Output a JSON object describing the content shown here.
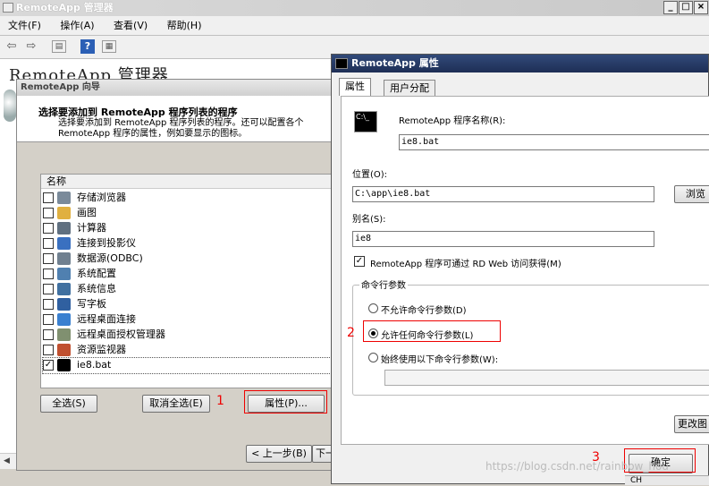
{
  "main_window": {
    "title": "RemoteApp 管理器",
    "menu": [
      "文件(F)",
      "操作(A)",
      "查看(V)",
      "帮助(H)"
    ],
    "heading": "RemoteApp 管理器"
  },
  "wizard": {
    "title": "RemoteApp 向导",
    "header_title": "选择要添加到 RemoteApp 程序列表的程序",
    "header_desc": "选择要添加到 RemoteApp 程序列表的程序。还可以配置各个 RemoteApp 程序的属性，例如要显示的图标。",
    "list_header": "名称",
    "items": [
      {
        "label": "存储浏览器",
        "checked": false,
        "color": "#7a8a9a"
      },
      {
        "label": "画图",
        "checked": false,
        "color": "#e0b040"
      },
      {
        "label": "计算器",
        "checked": false,
        "color": "#607080"
      },
      {
        "label": "连接到投影仪",
        "checked": false,
        "color": "#3a70c0"
      },
      {
        "label": "数据源(ODBC)",
        "checked": false,
        "color": "#708090"
      },
      {
        "label": "系统配置",
        "checked": false,
        "color": "#5080b0"
      },
      {
        "label": "系统信息",
        "checked": false,
        "color": "#4070a0"
      },
      {
        "label": "写字板",
        "checked": false,
        "color": "#3060a0"
      },
      {
        "label": "远程桌面连接",
        "checked": false,
        "color": "#3a80d0"
      },
      {
        "label": "远程桌面授权管理器",
        "checked": false,
        "color": "#809070"
      },
      {
        "label": "资源监视器",
        "checked": false,
        "color": "#c05030"
      },
      {
        "label": "ie8.bat",
        "checked": true,
        "color": "#000000"
      }
    ],
    "select_all": "全选(S)",
    "deselect_all": "取消全选(E)",
    "properties": "属性(P)...",
    "back": "< 上一步(B)",
    "next": "下一"
  },
  "properties_dialog": {
    "title": "RemoteApp 属性",
    "tabs": [
      "属性",
      "用户分配"
    ],
    "program_name_label": "RemoteApp 程序名称(R):",
    "program_name_value": "ie8.bat",
    "location_label": "位置(O):",
    "location_value": "C:\\app\\ie8.bat",
    "browse": "浏览",
    "alias_label": "别名(S):",
    "alias_value": "ie8",
    "rdweb_label": "RemoteApp 程序可通过 RD Web 访问获得(M)",
    "rdweb_checked": true,
    "cmdline_group": "命令行参数",
    "options": [
      "不允许命令行参数(D)",
      "允许任何命令行参数(L)",
      "始终使用以下命令行参数(W):"
    ],
    "selected_option": 1,
    "cmdline_value": "",
    "change_icon": "更改图",
    "ok": "确定",
    "lang_indicator": "CH"
  },
  "annotations": [
    "1",
    "2",
    "3"
  ],
  "watermark": "https://blog.csdn.net/rainbow_hou"
}
